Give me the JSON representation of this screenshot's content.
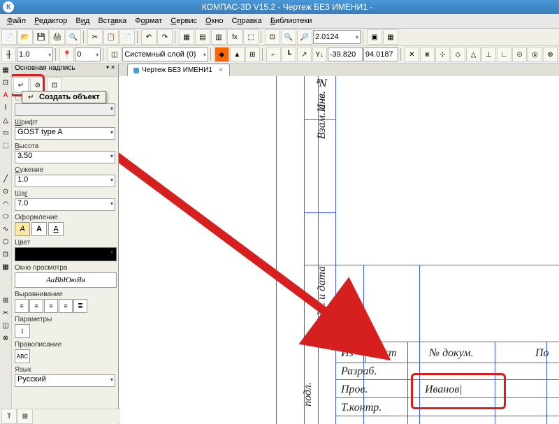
{
  "title": "КОМПАС-3D V15.2  - Чертеж БЕЗ ИМЕНИ1 -",
  "menu": [
    "Файл",
    "Редактор",
    "Вид",
    "Вставка",
    "Формат",
    "Сервис",
    "Окно",
    "Справка",
    "Библиотеки"
  ],
  "tb2": {
    "lw": "1.0",
    "layer": "Системный слой (0)",
    "coord1": "-39.820",
    "coord2": "94.0187"
  },
  "tb1": {
    "zoom": "2.0124"
  },
  "panel": {
    "title": "Основная надпись",
    "tooltip_cmd": "Создать объект",
    "ctx_cmd": "Создать объект",
    "style_lbl": "Стиль",
    "font_lbl": "Шрифт",
    "font": "GOST type A",
    "height_lbl": "Высота",
    "height": "3.50",
    "narrow_lbl": "Сужение",
    "narrow": "1.0",
    "step_lbl": "Шаг",
    "step": "7.0",
    "decor_lbl": "Оформление",
    "color_lbl": "Цвет",
    "view_lbl": "Окно просмотра",
    "view": "АаВbЮюЯя",
    "align_lbl": "Выравнивание",
    "param_lbl": "Параметры",
    "param": "↕",
    "spell_lbl": "Правописание",
    "spell": "ABC",
    "lang_lbl": "Язык",
    "lang": "Русский"
  },
  "tab": {
    "label": "Чертеж БЕЗ ИМЕНИ1"
  },
  "titleblock": {
    "inv_n": "Инв. №",
    "vzam": "Взам. инв. №",
    "podp_data": "Подп. и дата",
    "podl": "подл.",
    "izm": "Из",
    "list": "Лист",
    "ndoc": "№ докум.",
    "po": "По",
    "razrab": "Разраб.",
    "prov": "Пров.",
    "tkontr": "Т.контр.",
    "name": "Иванов|"
  }
}
